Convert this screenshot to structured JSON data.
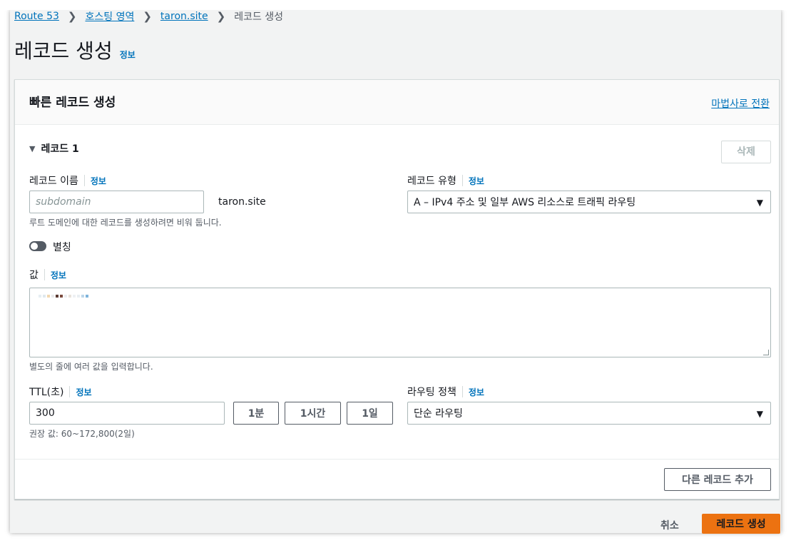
{
  "breadcrumb": {
    "items": [
      "Route 53",
      "호스팅 영역",
      "taron.site"
    ],
    "current": "레코드 생성"
  },
  "page": {
    "title": "레코드 생성",
    "info_label": "정보"
  },
  "panel": {
    "title": "빠른 레코드 생성",
    "wizard_link": "마법사로 전환"
  },
  "record": {
    "toggle_label": "레코드 1",
    "delete_label": "삭제",
    "name": {
      "label": "레코드 이름",
      "info": "정보",
      "placeholder": "subdomain",
      "suffix": "taron.site",
      "hint": "루트 도메인에 대한 레코드를 생성하려면 비워 둡니다."
    },
    "type": {
      "label": "레코드 유형",
      "info": "정보",
      "value": "A – IPv4 주소 및 일부 AWS 리소스로 트래픽 라우팅"
    },
    "alias": {
      "label": "별칭",
      "enabled": false
    },
    "value": {
      "label": "값",
      "info": "정보",
      "hint": "별도의 줄에 여러 값을 입력합니다."
    },
    "ttl": {
      "label": "TTL(초)",
      "info": "정보",
      "value": "300",
      "presets": [
        "1분",
        "1시간",
        "1일"
      ],
      "hint": "권장 값: 60~172,800(2일)"
    },
    "routing": {
      "label": "라우팅 정책",
      "info": "정보",
      "value": "단순 라우팅"
    }
  },
  "add_record_label": "다른 레코드 추가",
  "actions": {
    "cancel": "취소",
    "submit": "레코드 생성"
  },
  "colors": {
    "link": "#0073bb",
    "primary": "#ec7211",
    "border": "#aab7b8"
  }
}
